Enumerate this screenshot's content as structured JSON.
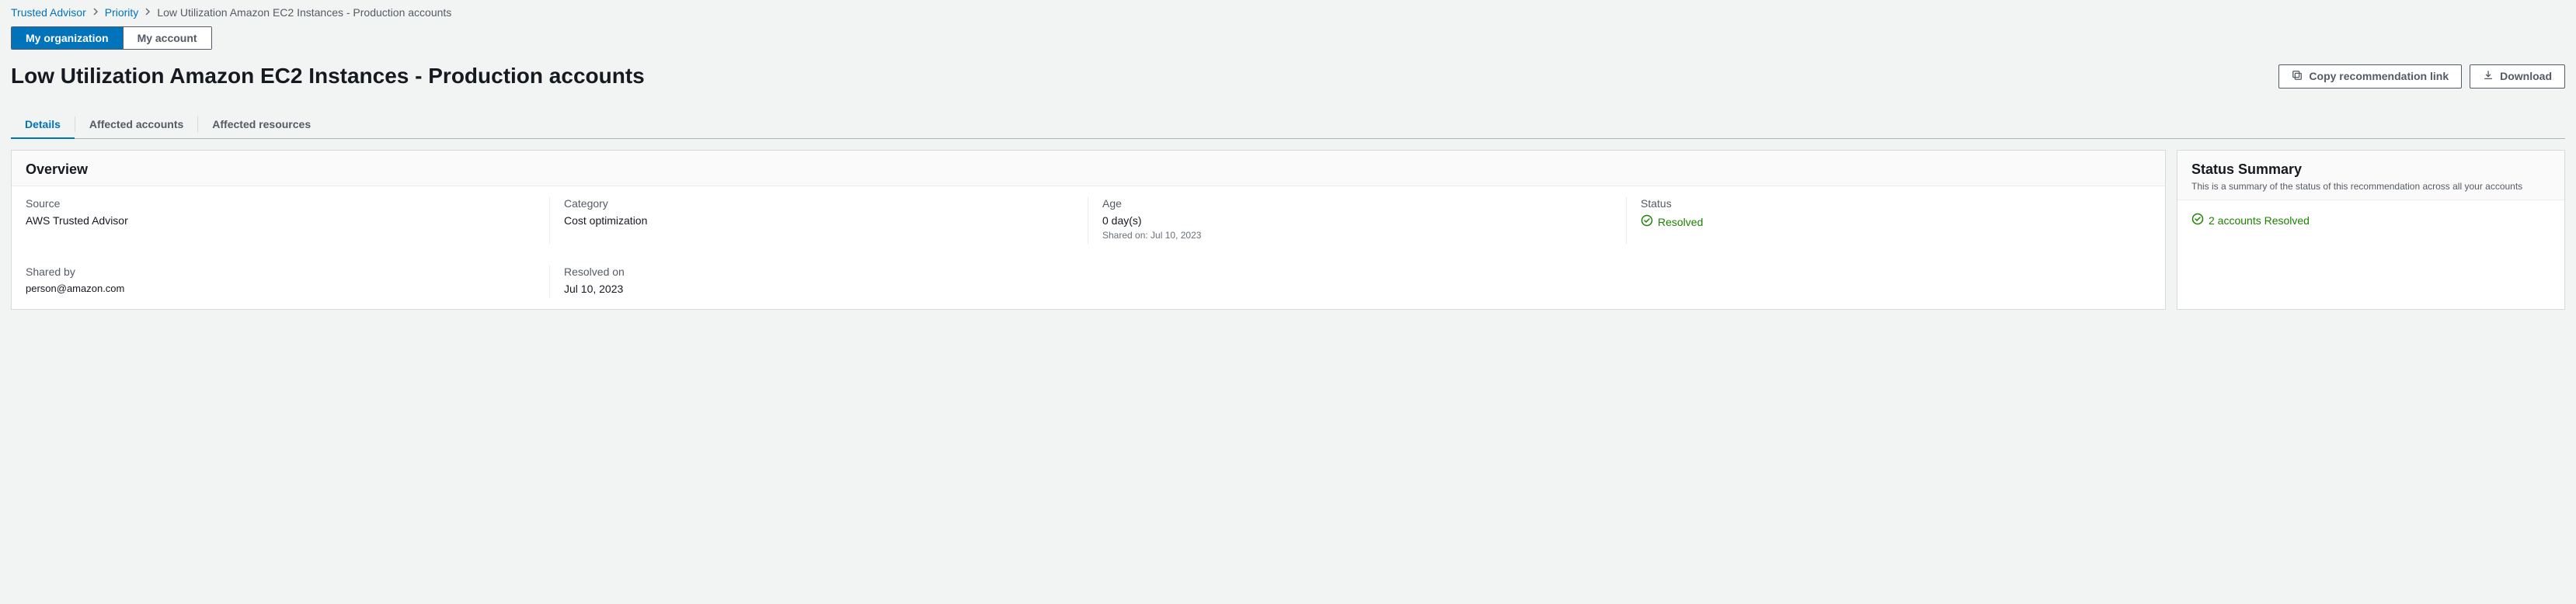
{
  "breadcrumb": {
    "root": "Trusted Advisor",
    "mid": "Priority",
    "current": "Low Utilization Amazon EC2 Instances - Production accounts"
  },
  "segmented": {
    "org": "My organization",
    "account": "My account"
  },
  "page_title": "Low Utilization Amazon EC2 Instances - Production accounts",
  "actions": {
    "copy": "Copy recommendation link",
    "download": "Download"
  },
  "tabs": {
    "details": "Details",
    "affected_accounts": "Affected accounts",
    "affected_resources": "Affected resources"
  },
  "overview": {
    "title": "Overview",
    "source_label": "Source",
    "source_value": "AWS Trusted Advisor",
    "category_label": "Category",
    "category_value": "Cost optimization",
    "age_label": "Age",
    "age_value": "0 day(s)",
    "shared_on": "Shared on: Jul 10, 2023",
    "status_label": "Status",
    "status_value": "Resolved",
    "shared_by_label": "Shared by",
    "shared_by_value": "person@amazon.com",
    "resolved_on_label": "Resolved on",
    "resolved_on_value": "Jul 10, 2023"
  },
  "status_summary": {
    "title": "Status Summary",
    "subtitle": "This is a summary of the status of this recommendation across all your accounts",
    "line": "2 accounts Resolved"
  }
}
